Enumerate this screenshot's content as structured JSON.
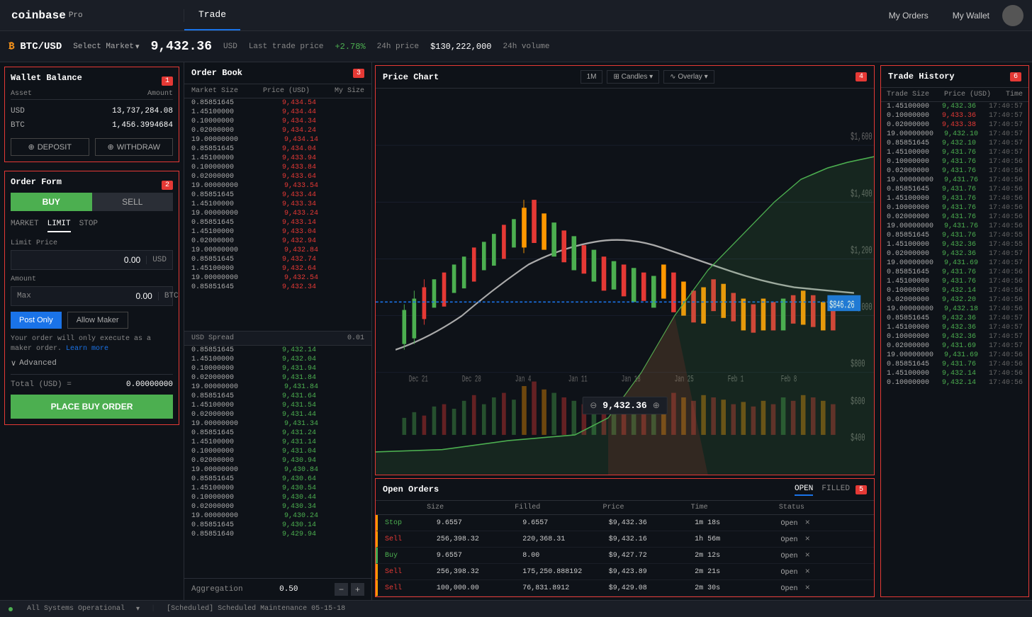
{
  "header": {
    "logo": "coinbase",
    "logo_pro": "Pro",
    "nav_trade": "Trade",
    "nav_orders": "My Orders",
    "nav_wallet": "My Wallet"
  },
  "market_bar": {
    "pair": "BTC/USD",
    "select_label": "Select Market",
    "price": "9,432.36",
    "price_currency": "USD",
    "price_label": "Last trade price",
    "change": "+2.78%",
    "change_label": "24h price",
    "volume": "$130,222,000",
    "volume_label": "24h volume"
  },
  "wallet": {
    "title": "Wallet Balance",
    "num": "1",
    "col_asset": "Asset",
    "col_amount": "Amount",
    "usd_label": "USD",
    "usd_amount": "13,737,284.08",
    "btc_label": "BTC",
    "btc_amount": "1,456.3994684",
    "deposit_label": "DEPOSIT",
    "withdraw_label": "WITHDRAW"
  },
  "order_form": {
    "title": "Order Form",
    "num": "2",
    "buy_label": "BUY",
    "sell_label": "SELL",
    "tab_market": "MARKET",
    "tab_limit": "LIMIT",
    "tab_stop": "STOP",
    "limit_price_label": "Limit Price",
    "limit_price_value": "0.00",
    "limit_price_currency": "USD",
    "amount_label": "Amount",
    "amount_max": "Max",
    "amount_value": "0.00",
    "amount_currency": "BTC",
    "post_only_label": "Post Only",
    "allow_maker_label": "Allow Maker",
    "note": "Your order will only execute as a maker order.",
    "note_link": "Learn more",
    "advanced_label": "Advanced",
    "total_label": "Total (USD) =",
    "total_value": "0.00000000",
    "place_order_label": "PLACE BUY ORDER"
  },
  "order_book": {
    "title": "Order Book",
    "num": "3",
    "col_market_size": "Market Size",
    "col_price": "Price (USD)",
    "col_my_size": "My Size",
    "asks": [
      {
        "size": "0.85851645",
        "price": "9,434.54"
      },
      {
        "size": "1.45100000",
        "price": "9,434.44"
      },
      {
        "size": "0.10000000",
        "price": "9,434.34"
      },
      {
        "size": "0.02000000",
        "price": "9,434.24"
      },
      {
        "size": "19.00000000",
        "price": "9,434.14"
      },
      {
        "size": "0.85851645",
        "price": "9,434.04"
      },
      {
        "size": "1.45100000",
        "price": "9,433.94"
      },
      {
        "size": "0.10000000",
        "price": "9,433.84"
      },
      {
        "size": "0.02000000",
        "price": "9,433.64"
      },
      {
        "size": "19.00000000",
        "price": "9,433.54"
      },
      {
        "size": "0.85851645",
        "price": "9,433.44"
      },
      {
        "size": "1.45100000",
        "price": "9,433.34"
      },
      {
        "size": "19.00000000",
        "price": "9,433.24"
      },
      {
        "size": "0.85851645",
        "price": "9,433.14"
      },
      {
        "size": "1.45100000",
        "price": "9,433.04"
      },
      {
        "size": "0.02000000",
        "price": "9,432.94"
      },
      {
        "size": "19.00000000",
        "price": "9,432.84"
      },
      {
        "size": "0.85851645",
        "price": "9,432.74"
      },
      {
        "size": "1.45100000",
        "price": "9,432.64"
      },
      {
        "size": "19.00000000",
        "price": "9,432.54"
      },
      {
        "size": "0.85851645",
        "price": "9,432.34"
      }
    ],
    "spread_label": "USD Spread",
    "spread_value": "0.01",
    "bids": [
      {
        "size": "0.85851645",
        "price": "9,432.14"
      },
      {
        "size": "1.45100000",
        "price": "9,432.04"
      },
      {
        "size": "0.10000000",
        "price": "9,431.94"
      },
      {
        "size": "0.02000000",
        "price": "9,431.84"
      },
      {
        "size": "19.00000000",
        "price": "9,431.84"
      },
      {
        "size": "0.85851645",
        "price": "9,431.64"
      },
      {
        "size": "1.45100000",
        "price": "9,431.54"
      },
      {
        "size": "0.02000000",
        "price": "9,431.44"
      },
      {
        "size": "19.00000000",
        "price": "9,431.34"
      },
      {
        "size": "0.85851645",
        "price": "9,431.24"
      },
      {
        "size": "1.45100000",
        "price": "9,431.14"
      },
      {
        "size": "0.10000000",
        "price": "9,431.04"
      },
      {
        "size": "0.02000000",
        "price": "9,430.94"
      },
      {
        "size": "19.00000000",
        "price": "9,430.84"
      },
      {
        "size": "0.85851645",
        "price": "9,430.64"
      },
      {
        "size": "1.45100000",
        "price": "9,430.54"
      },
      {
        "size": "0.10000000",
        "price": "9,430.44"
      },
      {
        "size": "0.02000000",
        "price": "9,430.34"
      },
      {
        "size": "19.00000000",
        "price": "9,430.24"
      },
      {
        "size": "0.85851645",
        "price": "9,430.14"
      },
      {
        "size": "0.85851640",
        "price": "9,429.94"
      }
    ],
    "aggregation_label": "Aggregation",
    "aggregation_value": "0.50"
  },
  "price_chart": {
    "title": "Price Chart",
    "num": "4",
    "current_price": "9,432.36",
    "candles_label": "Candles",
    "overlay_label": "Overlay"
  },
  "open_orders": {
    "title": "Open Orders",
    "num": "5",
    "tab_open": "OPEN",
    "tab_filled": "FILLED",
    "col_side": "",
    "col_size": "Size",
    "col_filled": "Filled",
    "col_price": "Price",
    "col_time": "Time",
    "col_status": "Status",
    "orders": [
      {
        "side": "Stop",
        "side_type": "stop",
        "size": "9.6557",
        "filled": "9.6557",
        "price": "$9,432.36",
        "time": "1m 18s",
        "status": "Open"
      },
      {
        "side": "Sell",
        "side_type": "sell",
        "size": "256,398.32",
        "filled": "220,368.31",
        "price": "$9,432.16",
        "time": "1h 56m",
        "status": "Open"
      },
      {
        "side": "Buy",
        "side_type": "buy",
        "size": "9.6557",
        "filled": "8.00",
        "price": "$9,427.72",
        "time": "2m 12s",
        "status": "Open"
      },
      {
        "side": "Sell",
        "side_type": "sell",
        "size": "256,398.32",
        "filled": "175,250.888192",
        "price": "$9,423.89",
        "time": "2m 21s",
        "status": "Open"
      },
      {
        "side": "Sell",
        "side_type": "sell",
        "size": "100,000.00",
        "filled": "76,831.8912",
        "price": "$9,429.08",
        "time": "2m 30s",
        "status": "Open"
      }
    ]
  },
  "trade_history": {
    "title": "Trade History",
    "num": "6",
    "col_trade_size": "Trade Size",
    "col_price": "Price (USD)",
    "col_time": "Time",
    "trades": [
      {
        "size": "1.45100000",
        "price": "9,432.36",
        "time": "17:40:57",
        "dir": "green"
      },
      {
        "size": "0.10000000",
        "price": "9,433.36",
        "time": "17:40:57",
        "dir": "red"
      },
      {
        "size": "0.02000000",
        "price": "9,433.38",
        "time": "17:40:57",
        "dir": "red"
      },
      {
        "size": "19.00000000",
        "price": "9,432.10",
        "time": "17:40:57",
        "dir": "green"
      },
      {
        "size": "0.85851645",
        "price": "9,432.10",
        "time": "17:40:57",
        "dir": "green"
      },
      {
        "size": "1.45100000",
        "price": "9,431.76",
        "time": "17:40:57",
        "dir": "green"
      },
      {
        "size": "0.10000000",
        "price": "9,431.76",
        "time": "17:40:56",
        "dir": "green"
      },
      {
        "size": "0.02000000",
        "price": "9,431.76",
        "time": "17:40:56",
        "dir": "green"
      },
      {
        "size": "19.00000000",
        "price": "9,431.76",
        "time": "17:40:56",
        "dir": "green"
      },
      {
        "size": "0.85851645",
        "price": "9,431.76",
        "time": "17:40:56",
        "dir": "green"
      },
      {
        "size": "1.45100000",
        "price": "9,431.76",
        "time": "17:40:56",
        "dir": "green"
      },
      {
        "size": "0.10000000",
        "price": "9,431.76",
        "time": "17:40:56",
        "dir": "green"
      },
      {
        "size": "0.02000000",
        "price": "9,431.76",
        "time": "17:40:56",
        "dir": "green"
      },
      {
        "size": "19.00000000",
        "price": "9,431.76",
        "time": "17:40:56",
        "dir": "green"
      },
      {
        "size": "0.85851645",
        "price": "9,431.76",
        "time": "17:40:55",
        "dir": "green"
      },
      {
        "size": "1.45100000",
        "price": "9,432.36",
        "time": "17:40:55",
        "dir": "green"
      },
      {
        "size": "0.02000000",
        "price": "9,432.36",
        "time": "17:40:57",
        "dir": "green"
      },
      {
        "size": "19.00000000",
        "price": "9,431.69",
        "time": "17:40:57",
        "dir": "green"
      },
      {
        "size": "0.85851645",
        "price": "9,431.76",
        "time": "17:40:56",
        "dir": "green"
      },
      {
        "size": "1.45100000",
        "price": "9,431.76",
        "time": "17:40:56",
        "dir": "green"
      },
      {
        "size": "0.10000000",
        "price": "9,432.14",
        "time": "17:40:56",
        "dir": "green"
      },
      {
        "size": "0.02000000",
        "price": "9,432.20",
        "time": "17:40:56",
        "dir": "green"
      },
      {
        "size": "19.00000000",
        "price": "9,432.18",
        "time": "17:40:56",
        "dir": "green"
      },
      {
        "size": "0.85851645",
        "price": "9,432.36",
        "time": "17:40:57",
        "dir": "green"
      },
      {
        "size": "1.45100000",
        "price": "9,432.36",
        "time": "17:40:57",
        "dir": "green"
      },
      {
        "size": "0.10000000",
        "price": "9,432.36",
        "time": "17:40:57",
        "dir": "green"
      },
      {
        "size": "0.02000000",
        "price": "9,431.69",
        "time": "17:40:57",
        "dir": "green"
      },
      {
        "size": "19.00000000",
        "price": "9,431.69",
        "time": "17:40:56",
        "dir": "green"
      },
      {
        "size": "0.85851645",
        "price": "9,431.76",
        "time": "17:40:56",
        "dir": "green"
      },
      {
        "size": "1.45100000",
        "price": "9,432.14",
        "time": "17:40:56",
        "dir": "green"
      },
      {
        "size": "0.10000000",
        "price": "9,432.14",
        "time": "17:40:56",
        "dir": "green"
      }
    ]
  },
  "status_bar": {
    "status": "All Systems Operational",
    "maintenance": "[Scheduled] Scheduled Maintenance 05-15-18"
  }
}
